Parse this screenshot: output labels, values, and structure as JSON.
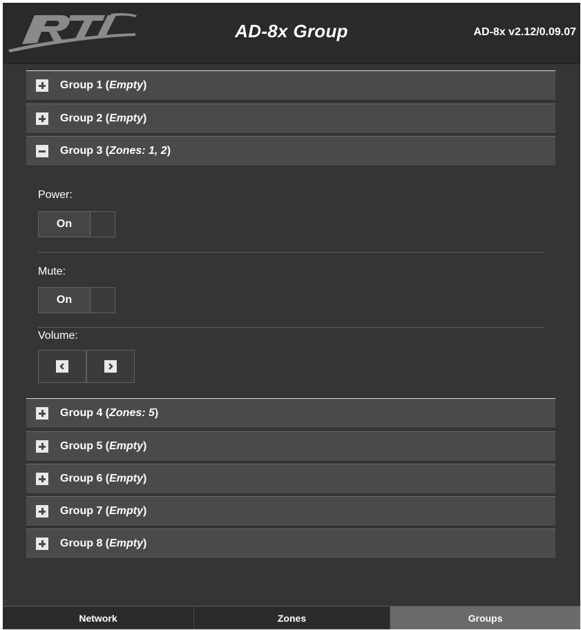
{
  "header": {
    "title": "AD-8x Group",
    "version": "AD-8x v2.12/0.09.07",
    "logo_text": "RTI"
  },
  "groups": [
    {
      "name": "Group 1",
      "status": "Empty",
      "expanded": false
    },
    {
      "name": "Group 2",
      "status": "Empty",
      "expanded": false
    },
    {
      "name": "Group 3",
      "status": "Zones: 1, 2",
      "expanded": true
    },
    {
      "name": "Group 4",
      "status": "Zones: 5",
      "expanded": false
    },
    {
      "name": "Group 5",
      "status": "Empty",
      "expanded": false
    },
    {
      "name": "Group 6",
      "status": "Empty",
      "expanded": false
    },
    {
      "name": "Group 7",
      "status": "Empty",
      "expanded": false
    },
    {
      "name": "Group 8",
      "status": "Empty",
      "expanded": false
    }
  ],
  "group_detail": {
    "power": {
      "label": "Power:",
      "value": "On"
    },
    "mute": {
      "label": "Mute:",
      "value": "On"
    },
    "volume": {
      "label": "Volume:"
    }
  },
  "tabs": [
    {
      "label": "Network",
      "active": false
    },
    {
      "label": "Zones",
      "active": false
    },
    {
      "label": "Groups",
      "active": true
    }
  ],
  "icons": {
    "expand": "plus-icon",
    "collapse": "minus-icon",
    "volume_down": "chevron-left-icon",
    "volume_up": "chevron-right-icon"
  },
  "colors": {
    "background": "#353535",
    "header": "#2a2a2a",
    "group_header": "#4a4a4a",
    "active_tab": "#6a6a6a",
    "text": "#ffffff"
  }
}
